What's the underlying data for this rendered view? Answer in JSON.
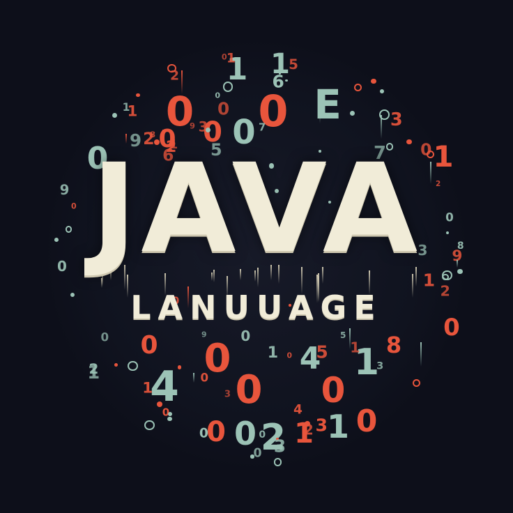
{
  "title": "JAVA",
  "subtitle": "LANUUAGE",
  "colors": {
    "background": "#0d0f1a",
    "title": "#f1ecd8",
    "accent_red": "#e8553c",
    "accent_teal": "#9cc3b6"
  },
  "scatter": {
    "large": [
      "0",
      "0",
      "E",
      "1",
      "1",
      "0",
      "0",
      "0",
      "1",
      "0",
      "0",
      "4",
      "0",
      "0",
      "4",
      "1",
      "0",
      "0",
      "2",
      "1",
      "1",
      "0",
      "0",
      "0",
      "8"
    ],
    "small": [
      "9",
      "8",
      "1",
      "2",
      "0",
      "3",
      "0",
      "5",
      "1",
      "0",
      "7",
      "2",
      "4",
      "2",
      "0",
      "9",
      "8",
      "1",
      "0",
      "3",
      "6",
      "2",
      "1",
      "0",
      "0",
      "7",
      "5",
      "0",
      "1",
      "0"
    ]
  }
}
